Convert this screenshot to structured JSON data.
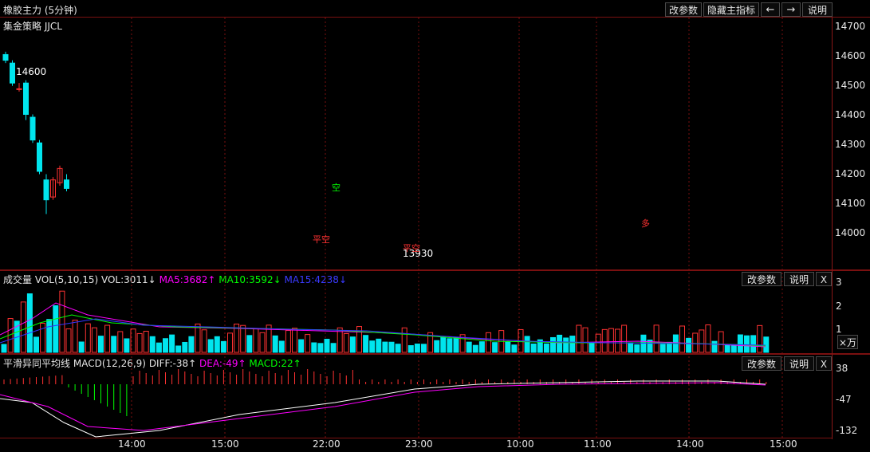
{
  "header": {
    "title": "橡胶主力 (5分钟)",
    "buttons": [
      "改参数",
      "隐藏主指标",
      "←",
      "→",
      "说明"
    ]
  },
  "main_panel": {
    "strategy_label": "集金策略 JJCL",
    "y_ticks": [
      "14700",
      "14600",
      "14500",
      "14400",
      "14300",
      "14200",
      "14100",
      "14000"
    ],
    "annotations": {
      "high_price": "14600",
      "low_price": "13930",
      "signal_short": "空",
      "signal_close_short": "平空",
      "signal_close_short2": "平空",
      "signal_long": "多"
    }
  },
  "volume_panel": {
    "title": "成交量",
    "vol_params": "VOL(5,10,15)",
    "vol_value": "VOL:3011↓",
    "ma5": "MA5:3682↑",
    "ma10": "MA10:3592↓",
    "ma15": "MA15:4238↓",
    "buttons": [
      "改参数",
      "说明",
      "X"
    ],
    "y_ticks": [
      "3",
      "2",
      "1"
    ],
    "unit_button": "×万"
  },
  "macd_panel": {
    "title": "平滑异同平均线",
    "params": "MACD(12,26,9)",
    "diff": "DIFF:-38↑",
    "dea": "DEA:-49↑",
    "macd": "MACD:22↑",
    "buttons": [
      "改参数",
      "说明",
      "X"
    ],
    "y_ticks": [
      "38",
      "-47",
      "-132"
    ]
  },
  "x_axis": [
    "14:00",
    "15:00",
    "22:00",
    "23:00",
    "10:00",
    "11:00",
    "14:00",
    "15:00"
  ],
  "colors": {
    "up": "#ff3232",
    "down": "#00e5ee",
    "ma5": "#ff00ff",
    "ma10": "#00ff00",
    "ma15": "#3333ff",
    "grid": "#7a1010",
    "white": "#ffffff"
  },
  "chart_data": {
    "type": "candlestick",
    "ohlc_note": "5-minute rubber futures candles (approximate), price axis 13900-14720",
    "ylim": [
      13900,
      14720
    ],
    "candles": [
      {
        "o": 14590,
        "h": 14600,
        "l": 14560,
        "c": 14570
      },
      {
        "o": 14560,
        "h": 14570,
        "l": 14480,
        "c": 14490
      },
      {
        "o": 14470,
        "h": 14490,
        "l": 14460,
        "c": 14470
      },
      {
        "o": 14490,
        "h": 14500,
        "l": 14360,
        "c": 14380
      },
      {
        "o": 14370,
        "h": 14380,
        "l": 14280,
        "c": 14290
      },
      {
        "o": 14280,
        "h": 14290,
        "l": 14170,
        "c": 14180
      },
      {
        "o": 14150,
        "h": 14170,
        "l": 14030,
        "c": 14080
      },
      {
        "o": 14090,
        "h": 14160,
        "l": 14080,
        "c": 14150
      },
      {
        "o": 14140,
        "h": 14200,
        "l": 14130,
        "c": 14190
      },
      {
        "o": 14150,
        "h": 14170,
        "l": 14110,
        "c": 14120
      }
    ]
  }
}
